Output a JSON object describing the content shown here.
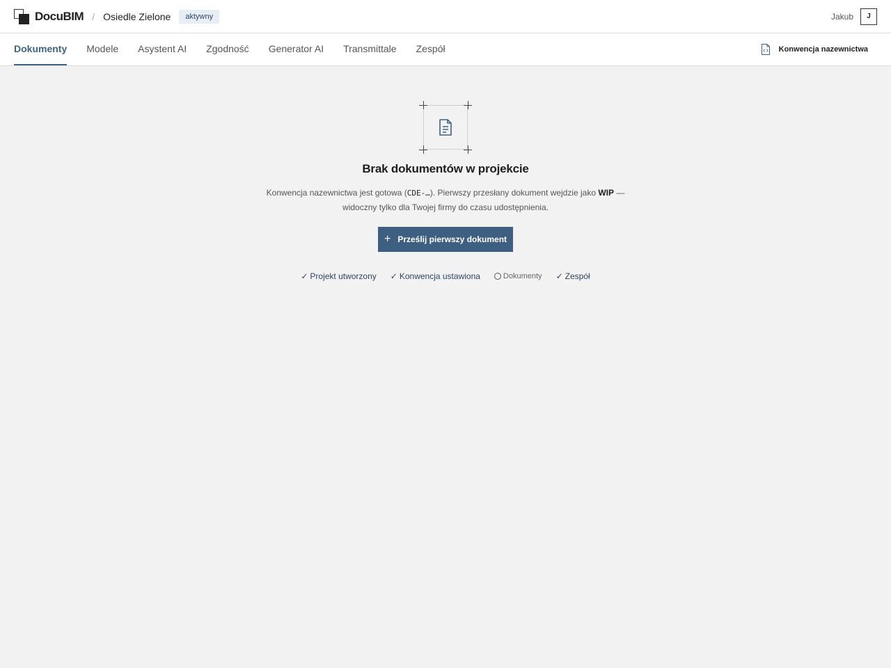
{
  "header": {
    "logo_text": "DocuBIM",
    "breadcrumb_sep": "/",
    "project_name": "Osiedle Zielone",
    "status": "aktywny",
    "user_name": "Jakub",
    "avatar_initial": "J"
  },
  "tabs": [
    {
      "label": "Dokumenty",
      "active": true
    },
    {
      "label": "Modele"
    },
    {
      "label": "Asystent AI"
    },
    {
      "label": "Zgodność"
    },
    {
      "label": "Generator AI"
    },
    {
      "label": "Transmittale"
    },
    {
      "label": "Zespół"
    }
  ],
  "toolbar": {
    "naming_label": "Konwencja nazewnictwa"
  },
  "empty_state": {
    "icon": "document-icon",
    "title": "Brak dokumentów w projekcie",
    "desc_part1": "Konwencja nazewnictwa jest gotowa (",
    "desc_code": "CDE-…",
    "desc_part2": "). Pierwszy przesłany dokument wejdzie jako ",
    "desc_bold": "WIP",
    "desc_part3": " — widoczny tylko dla Twojej firmy do czasu udostępnienia.",
    "button_label": "Prześlij pierwszy dokument"
  },
  "steps": [
    {
      "label": "Projekt utworzony",
      "mark": "✓"
    },
    {
      "label": "Konwencja ustawiona",
      "mark": "✓"
    },
    {
      "label": "Dokumenty",
      "mark": ""
    },
    {
      "label": "Zespół",
      "mark": "✓"
    }
  ],
  "colors": {
    "accent": "#3f6285",
    "button": "#3f5f80",
    "background": "#f2f2f2"
  }
}
